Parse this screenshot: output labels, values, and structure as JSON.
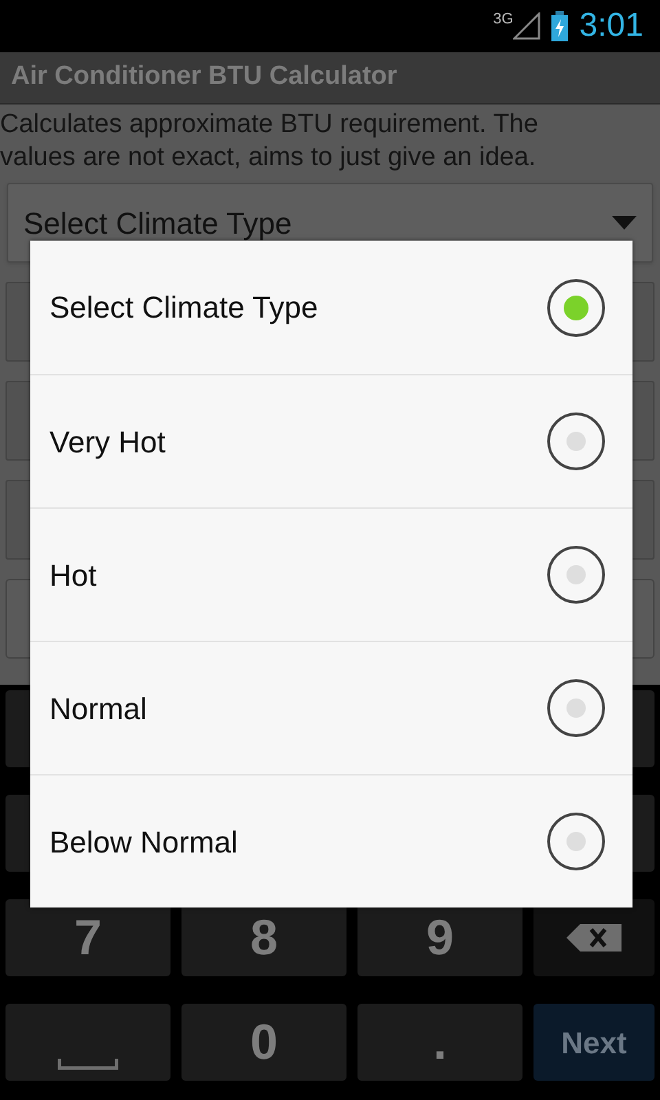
{
  "status_bar": {
    "network": "3G",
    "time": "3:01"
  },
  "title": "Air Conditioner BTU Calculator",
  "description": "Calculates approximate BTU requirement. The values are not exact, aims to just give an idea.",
  "spinner": {
    "value": "Select Climate Type"
  },
  "dialog": {
    "options": [
      {
        "label": "Select Climate Type",
        "selected": true
      },
      {
        "label": "Very Hot",
        "selected": false
      },
      {
        "label": "Hot",
        "selected": false
      },
      {
        "label": "Normal",
        "selected": false
      },
      {
        "label": "Below Normal",
        "selected": false
      }
    ]
  },
  "keyboard": {
    "rows": [
      [
        {
          "kind": "text",
          "label": "7"
        },
        {
          "kind": "text",
          "label": "8"
        },
        {
          "kind": "text",
          "label": "9"
        },
        {
          "kind": "backspace"
        }
      ],
      [
        {
          "kind": "space"
        },
        {
          "kind": "text",
          "label": "0"
        },
        {
          "kind": "text",
          "label": "."
        },
        {
          "kind": "action",
          "label": "Next"
        }
      ]
    ]
  }
}
